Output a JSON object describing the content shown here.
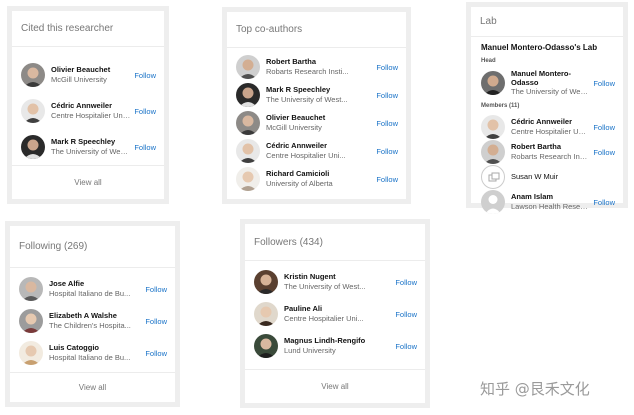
{
  "cited": {
    "title": "Cited this researcher",
    "footer": "View all",
    "people": [
      {
        "name": "Olivier Beauchet",
        "affiliation": "McGill University",
        "follow": "Follow"
      },
      {
        "name": "Cédric Annweiler",
        "affiliation": "Centre Hospitalier Uni...",
        "follow": "Follow"
      },
      {
        "name": "Mark R Speechley",
        "affiliation": "The University of West...",
        "follow": "Follow"
      }
    ]
  },
  "coauthors": {
    "title": "Top co-authors",
    "people": [
      {
        "name": "Robert Bartha",
        "affiliation": "Robarts Research Insti...",
        "follow": "Follow"
      },
      {
        "name": "Mark R Speechley",
        "affiliation": "The University of West...",
        "follow": "Follow"
      },
      {
        "name": "Olivier Beauchet",
        "affiliation": "McGill University",
        "follow": "Follow"
      },
      {
        "name": "Cédric Annweiler",
        "affiliation": "Centre Hospitalier Uni...",
        "follow": "Follow"
      },
      {
        "name": "Richard Camicioli",
        "affiliation": "University of Alberta",
        "follow": "Follow"
      }
    ]
  },
  "lab": {
    "title": "Lab",
    "lab_name": "Manuel Montero-Odasso's Lab",
    "head_label": "Head",
    "members_label": "Members (11)",
    "head": {
      "name": "Manuel Montero-Odasso",
      "affiliation": "The University of West...",
      "follow": "Follow"
    },
    "members": [
      {
        "name": "Cédric Annweiler",
        "affiliation": "Centre Hospitalier Uni...",
        "follow": "Follow"
      },
      {
        "name": "Robert Bartha",
        "affiliation": "Robarts Research Insti...",
        "follow": "Follow"
      },
      {
        "name": "Susan W Muir",
        "affiliation": "",
        "follow": ""
      },
      {
        "name": "Anam Islam",
        "affiliation": "Lawson Health Resear...",
        "follow": "Follow"
      }
    ]
  },
  "following": {
    "title": "Following (269)",
    "footer": "View all",
    "people": [
      {
        "name": "Jose Alfie",
        "affiliation": "Hospital Italiano de Bu...",
        "follow": "Follow"
      },
      {
        "name": "Elizabeth A Walshe",
        "affiliation": "The Children's Hospita...",
        "follow": "Follow"
      },
      {
        "name": "Luis Catoggio",
        "affiliation": "Hospital Italiano de Bu...",
        "follow": "Follow"
      }
    ]
  },
  "followers": {
    "title": "Followers (434)",
    "footer": "View all",
    "people": [
      {
        "name": "Kristin Nugent",
        "affiliation": "The University of West...",
        "follow": "Follow"
      },
      {
        "name": "Pauline Ali",
        "affiliation": "Centre Hospitalier Uni...",
        "follow": "Follow"
      },
      {
        "name": "Magnus Lindh-Rengifo",
        "affiliation": "Lund University",
        "follow": "Follow"
      }
    ]
  },
  "watermark": "知乎 @艮禾文化",
  "colors": {
    "link": "#1a73c8",
    "border": "#eeeeee",
    "muted": "#777777"
  }
}
